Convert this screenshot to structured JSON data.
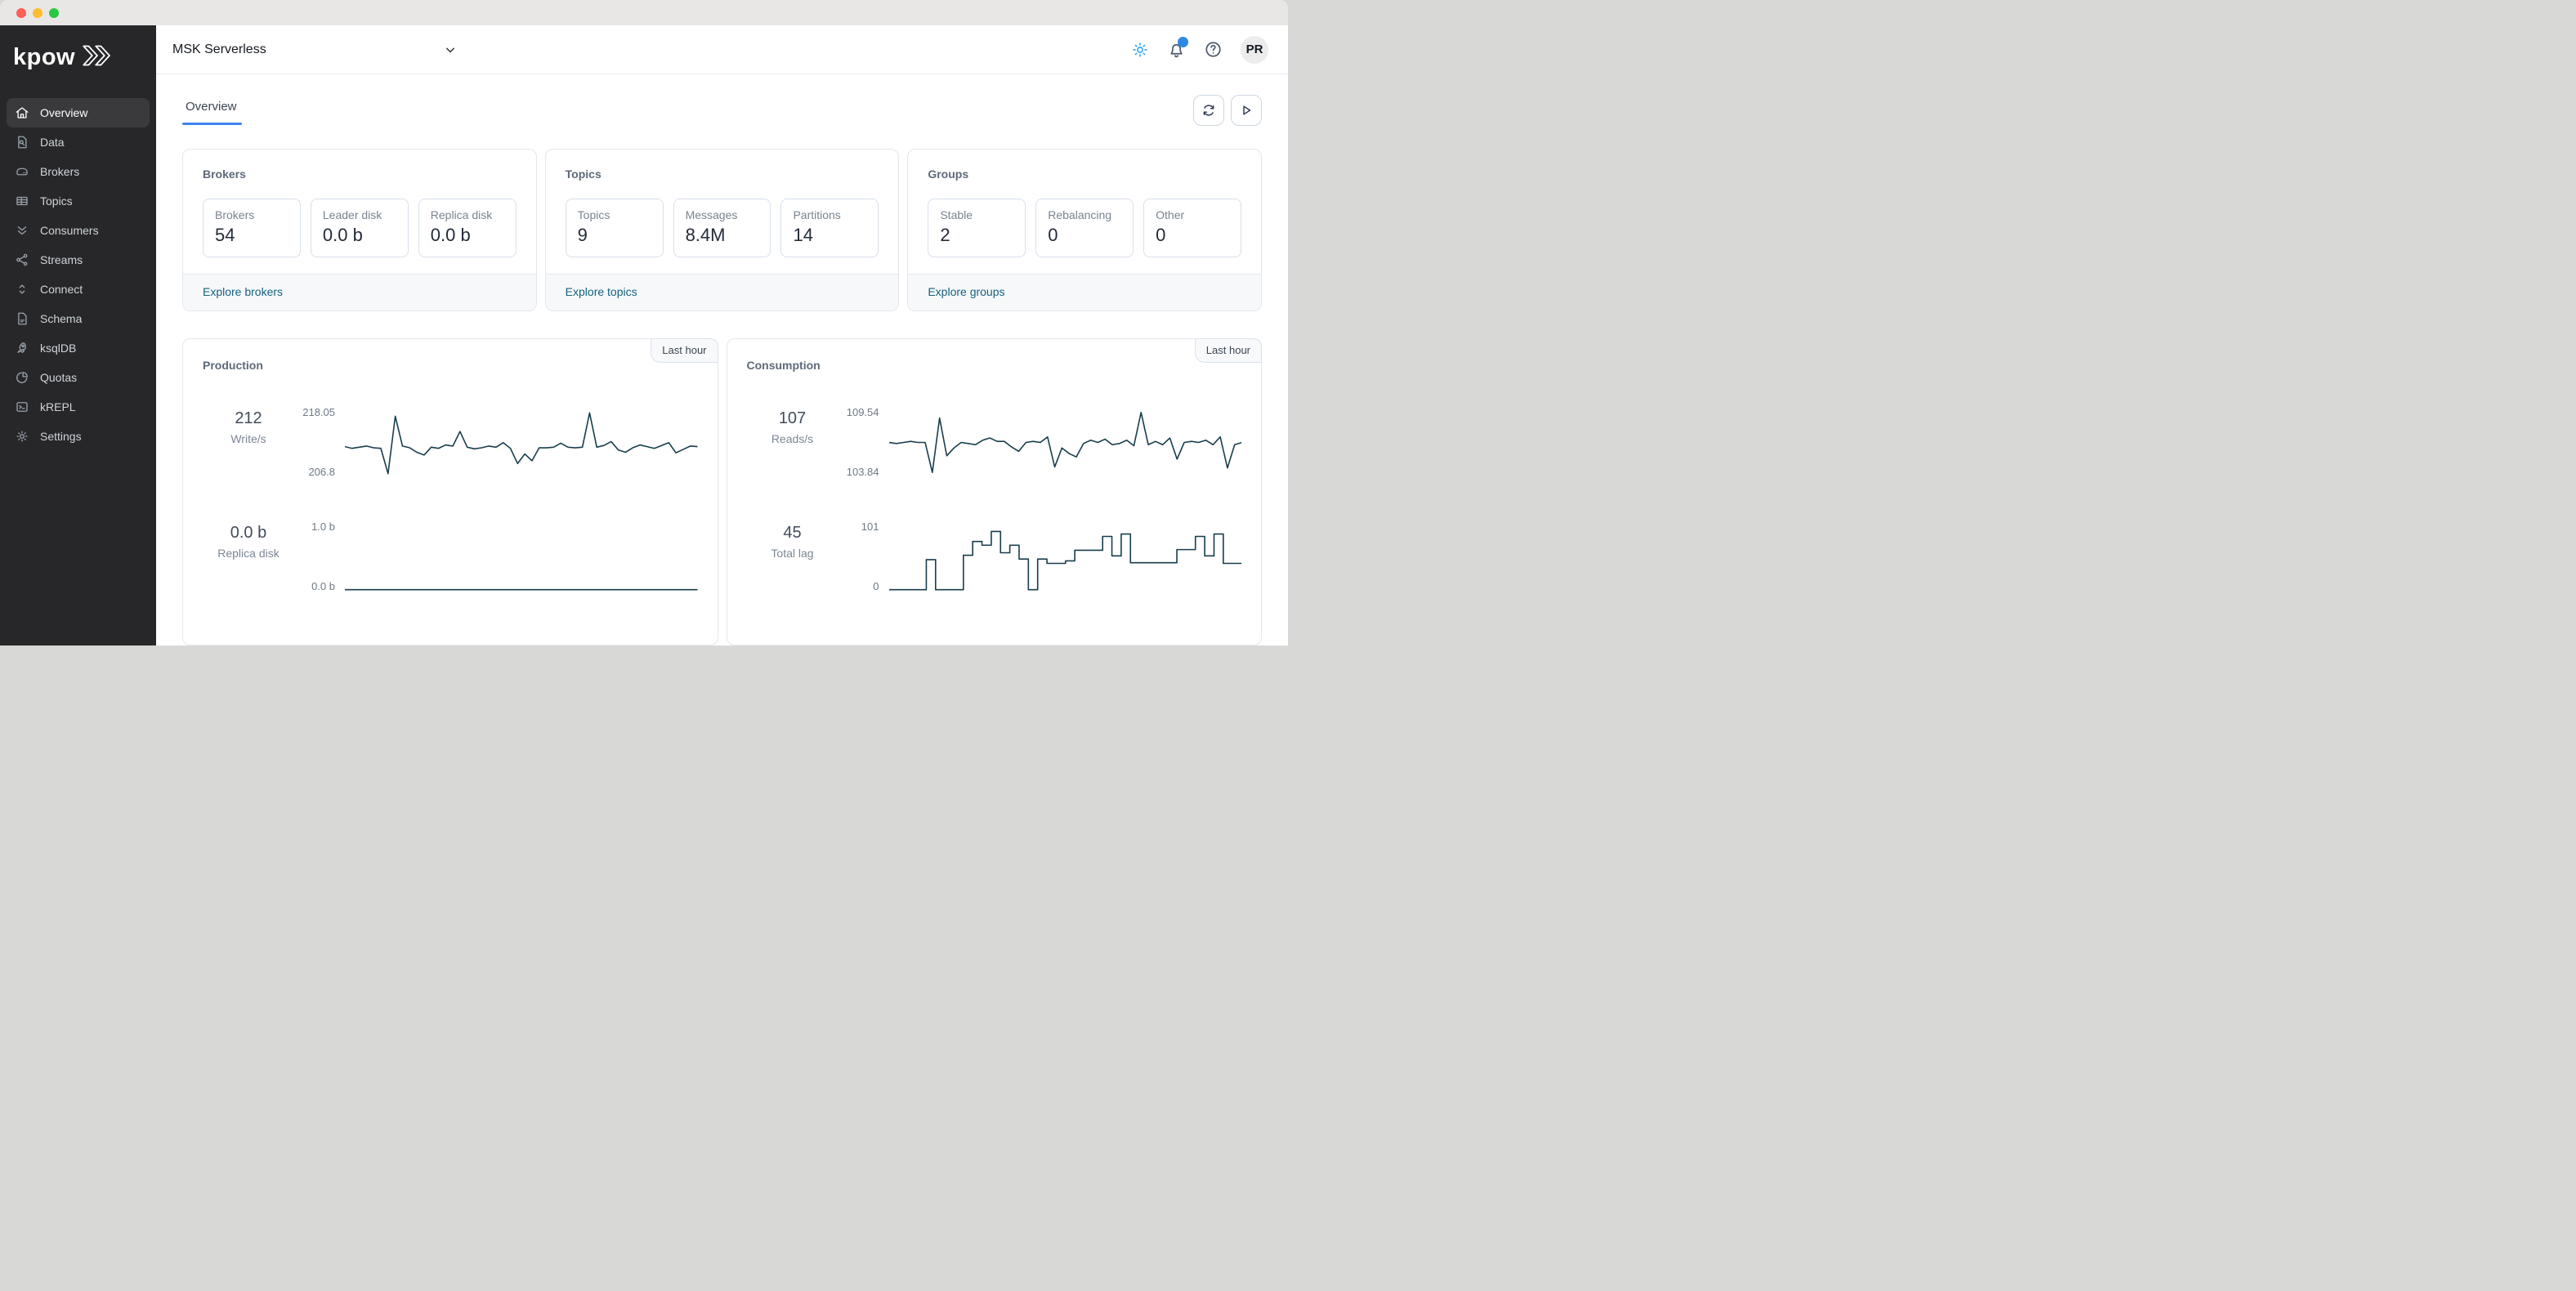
{
  "window": {
    "controls": [
      "close",
      "minimize",
      "zoom"
    ]
  },
  "colors": {
    "accent_blue": "#4284f0",
    "link": "#15627e",
    "chart_line": "#173e4c",
    "theme_icon": "#3aa7f2",
    "notification_dot": "#2f88e3"
  },
  "sidebar": {
    "logo_text": "kpow",
    "items": [
      {
        "label": "Overview",
        "icon": "home-icon",
        "active": true
      },
      {
        "label": "Data",
        "icon": "file-search-icon",
        "active": false
      },
      {
        "label": "Brokers",
        "icon": "hard-drive-icon",
        "active": false
      },
      {
        "label": "Topics",
        "icon": "table-icon",
        "active": false
      },
      {
        "label": "Consumers",
        "icon": "chevrons-down-icon",
        "active": false
      },
      {
        "label": "Streams",
        "icon": "share-icon",
        "active": false
      },
      {
        "label": "Connect",
        "icon": "chevrons-up-down-icon",
        "active": false
      },
      {
        "label": "Schema",
        "icon": "file-text-icon",
        "active": false
      },
      {
        "label": "ksqlDB",
        "icon": "rocket-icon",
        "active": false
      },
      {
        "label": "Quotas",
        "icon": "pie-chart-icon",
        "active": false
      },
      {
        "label": "kREPL",
        "icon": "terminal-icon",
        "active": false
      },
      {
        "label": "Settings",
        "icon": "gear-icon",
        "active": false
      }
    ]
  },
  "topbar": {
    "cluster_name": "MSK Serverless",
    "icons": [
      "theme-toggle",
      "notifications",
      "help"
    ],
    "avatar_initials": "PR"
  },
  "tabs": [
    {
      "label": "Overview",
      "active": true
    }
  ],
  "cards": [
    {
      "title": "Brokers",
      "tiles": [
        {
          "label": "Brokers",
          "value": "54"
        },
        {
          "label": "Leader disk",
          "value": "0.0 b"
        },
        {
          "label": "Replica disk",
          "value": "0.0 b"
        }
      ],
      "footer_link": "Explore brokers"
    },
    {
      "title": "Topics",
      "tiles": [
        {
          "label": "Topics",
          "value": "9"
        },
        {
          "label": "Messages",
          "value": "8.4M"
        },
        {
          "label": "Partitions",
          "value": "14"
        }
      ],
      "footer_link": "Explore topics"
    },
    {
      "title": "Groups",
      "tiles": [
        {
          "label": "Stable",
          "value": "2"
        },
        {
          "label": "Rebalancing",
          "value": "0"
        },
        {
          "label": "Other",
          "value": "0"
        }
      ],
      "footer_link": "Explore groups"
    }
  ],
  "chart_data": {
    "production": {
      "title": "Production",
      "badge": "Last hour",
      "rows": [
        {
          "type": "line",
          "current": "212",
          "metric": "Write/s",
          "ymax_label": "218.05",
          "ymin_label": "206.8",
          "ymin": 206.8,
          "ymax": 218.05,
          "values": [
            211.9,
            211.6,
            211.8,
            212.0,
            211.7,
            211.6,
            207.1,
            217.3,
            212.0,
            211.7,
            210.9,
            210.4,
            211.8,
            211.6,
            212.2,
            212.0,
            214.6,
            211.8,
            211.5,
            211.7,
            212.0,
            211.8,
            212.6,
            211.6,
            208.9,
            210.6,
            209.4,
            211.7,
            211.7,
            211.8,
            212.5,
            211.8,
            211.7,
            211.8,
            217.9,
            211.8,
            212.1,
            212.8,
            211.3,
            210.9,
            211.7,
            212.2,
            211.9,
            211.6,
            212.1,
            212.6,
            210.8,
            211.4,
            212.0,
            211.9
          ]
        },
        {
          "type": "line",
          "current": "0.0 b",
          "metric": "Replica disk",
          "ymax_label": "1.0 b",
          "ymin_label": "0.0 b",
          "ymin": 0,
          "ymax": 1,
          "values": [
            0,
            0
          ]
        }
      ]
    },
    "consumption": {
      "title": "Consumption",
      "badge": "Last hour",
      "rows": [
        {
          "type": "line",
          "current": "107",
          "metric": "Reads/s",
          "ymax_label": "109.54",
          "ymin_label": "103.84",
          "ymin": 103.84,
          "ymax": 109.54,
          "values": [
            106.8,
            106.7,
            106.8,
            106.9,
            106.8,
            106.8,
            104.1,
            109.0,
            105.6,
            106.3,
            106.8,
            106.7,
            106.6,
            107.0,
            107.2,
            106.9,
            106.9,
            106.4,
            106.0,
            106.8,
            106.9,
            106.8,
            107.3,
            104.6,
            106.3,
            105.8,
            105.5,
            106.7,
            107.0,
            106.8,
            107.1,
            106.6,
            106.7,
            107.0,
            106.5,
            109.5,
            106.6,
            106.9,
            106.6,
            107.2,
            105.3,
            106.8,
            106.9,
            106.8,
            107.0,
            106.6,
            107.3,
            104.5,
            106.6,
            106.8
          ]
        },
        {
          "type": "step",
          "current": "45",
          "metric": "Total lag",
          "ymax_label": "101",
          "ymin_label": "0",
          "ymin": 0,
          "ymax": 101,
          "values": [
            0,
            0,
            0,
            0,
            48,
            0,
            0,
            0,
            55,
            77,
            71,
            93,
            59,
            71,
            49,
            0,
            49,
            42,
            42,
            46,
            63,
            63,
            63,
            85,
            54,
            89,
            43,
            43,
            43,
            43,
            43,
            64,
            64,
            85,
            54,
            89,
            42,
            42,
            42
          ]
        }
      ]
    }
  }
}
